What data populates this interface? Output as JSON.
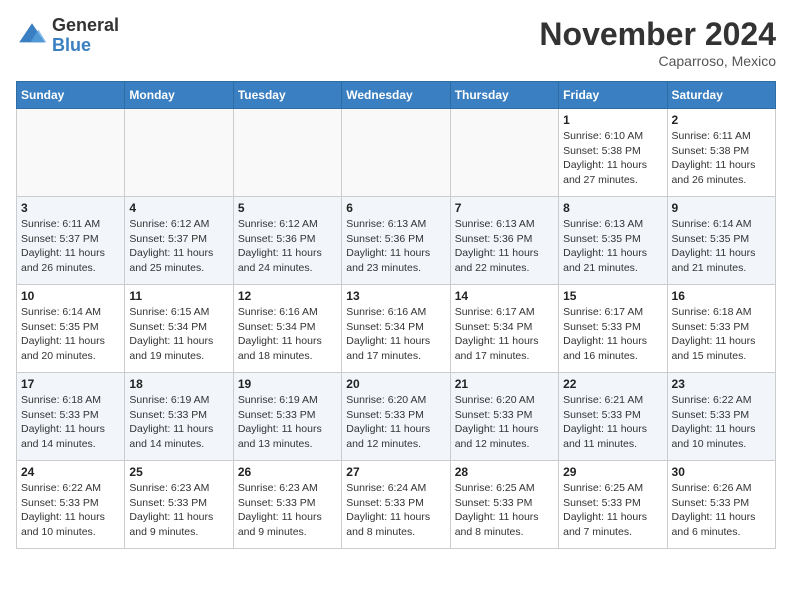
{
  "header": {
    "logo_line1": "General",
    "logo_line2": "Blue",
    "month": "November 2024",
    "location": "Caparroso, Mexico"
  },
  "weekdays": [
    "Sunday",
    "Monday",
    "Tuesday",
    "Wednesday",
    "Thursday",
    "Friday",
    "Saturday"
  ],
  "weeks": [
    [
      {
        "day": "",
        "info": ""
      },
      {
        "day": "",
        "info": ""
      },
      {
        "day": "",
        "info": ""
      },
      {
        "day": "",
        "info": ""
      },
      {
        "day": "",
        "info": ""
      },
      {
        "day": "1",
        "info": "Sunrise: 6:10 AM\nSunset: 5:38 PM\nDaylight: 11 hours\nand 27 minutes."
      },
      {
        "day": "2",
        "info": "Sunrise: 6:11 AM\nSunset: 5:38 PM\nDaylight: 11 hours\nand 26 minutes."
      }
    ],
    [
      {
        "day": "3",
        "info": "Sunrise: 6:11 AM\nSunset: 5:37 PM\nDaylight: 11 hours\nand 26 minutes."
      },
      {
        "day": "4",
        "info": "Sunrise: 6:12 AM\nSunset: 5:37 PM\nDaylight: 11 hours\nand 25 minutes."
      },
      {
        "day": "5",
        "info": "Sunrise: 6:12 AM\nSunset: 5:36 PM\nDaylight: 11 hours\nand 24 minutes."
      },
      {
        "day": "6",
        "info": "Sunrise: 6:13 AM\nSunset: 5:36 PM\nDaylight: 11 hours\nand 23 minutes."
      },
      {
        "day": "7",
        "info": "Sunrise: 6:13 AM\nSunset: 5:36 PM\nDaylight: 11 hours\nand 22 minutes."
      },
      {
        "day": "8",
        "info": "Sunrise: 6:13 AM\nSunset: 5:35 PM\nDaylight: 11 hours\nand 21 minutes."
      },
      {
        "day": "9",
        "info": "Sunrise: 6:14 AM\nSunset: 5:35 PM\nDaylight: 11 hours\nand 21 minutes."
      }
    ],
    [
      {
        "day": "10",
        "info": "Sunrise: 6:14 AM\nSunset: 5:35 PM\nDaylight: 11 hours\nand 20 minutes."
      },
      {
        "day": "11",
        "info": "Sunrise: 6:15 AM\nSunset: 5:34 PM\nDaylight: 11 hours\nand 19 minutes."
      },
      {
        "day": "12",
        "info": "Sunrise: 6:16 AM\nSunset: 5:34 PM\nDaylight: 11 hours\nand 18 minutes."
      },
      {
        "day": "13",
        "info": "Sunrise: 6:16 AM\nSunset: 5:34 PM\nDaylight: 11 hours\nand 17 minutes."
      },
      {
        "day": "14",
        "info": "Sunrise: 6:17 AM\nSunset: 5:34 PM\nDaylight: 11 hours\nand 17 minutes."
      },
      {
        "day": "15",
        "info": "Sunrise: 6:17 AM\nSunset: 5:33 PM\nDaylight: 11 hours\nand 16 minutes."
      },
      {
        "day": "16",
        "info": "Sunrise: 6:18 AM\nSunset: 5:33 PM\nDaylight: 11 hours\nand 15 minutes."
      }
    ],
    [
      {
        "day": "17",
        "info": "Sunrise: 6:18 AM\nSunset: 5:33 PM\nDaylight: 11 hours\nand 14 minutes."
      },
      {
        "day": "18",
        "info": "Sunrise: 6:19 AM\nSunset: 5:33 PM\nDaylight: 11 hours\nand 14 minutes."
      },
      {
        "day": "19",
        "info": "Sunrise: 6:19 AM\nSunset: 5:33 PM\nDaylight: 11 hours\nand 13 minutes."
      },
      {
        "day": "20",
        "info": "Sunrise: 6:20 AM\nSunset: 5:33 PM\nDaylight: 11 hours\nand 12 minutes."
      },
      {
        "day": "21",
        "info": "Sunrise: 6:20 AM\nSunset: 5:33 PM\nDaylight: 11 hours\nand 12 minutes."
      },
      {
        "day": "22",
        "info": "Sunrise: 6:21 AM\nSunset: 5:33 PM\nDaylight: 11 hours\nand 11 minutes."
      },
      {
        "day": "23",
        "info": "Sunrise: 6:22 AM\nSunset: 5:33 PM\nDaylight: 11 hours\nand 10 minutes."
      }
    ],
    [
      {
        "day": "24",
        "info": "Sunrise: 6:22 AM\nSunset: 5:33 PM\nDaylight: 11 hours\nand 10 minutes."
      },
      {
        "day": "25",
        "info": "Sunrise: 6:23 AM\nSunset: 5:33 PM\nDaylight: 11 hours\nand 9 minutes."
      },
      {
        "day": "26",
        "info": "Sunrise: 6:23 AM\nSunset: 5:33 PM\nDaylight: 11 hours\nand 9 minutes."
      },
      {
        "day": "27",
        "info": "Sunrise: 6:24 AM\nSunset: 5:33 PM\nDaylight: 11 hours\nand 8 minutes."
      },
      {
        "day": "28",
        "info": "Sunrise: 6:25 AM\nSunset: 5:33 PM\nDaylight: 11 hours\nand 8 minutes."
      },
      {
        "day": "29",
        "info": "Sunrise: 6:25 AM\nSunset: 5:33 PM\nDaylight: 11 hours\nand 7 minutes."
      },
      {
        "day": "30",
        "info": "Sunrise: 6:26 AM\nSunset: 5:33 PM\nDaylight: 11 hours\nand 6 minutes."
      }
    ]
  ]
}
